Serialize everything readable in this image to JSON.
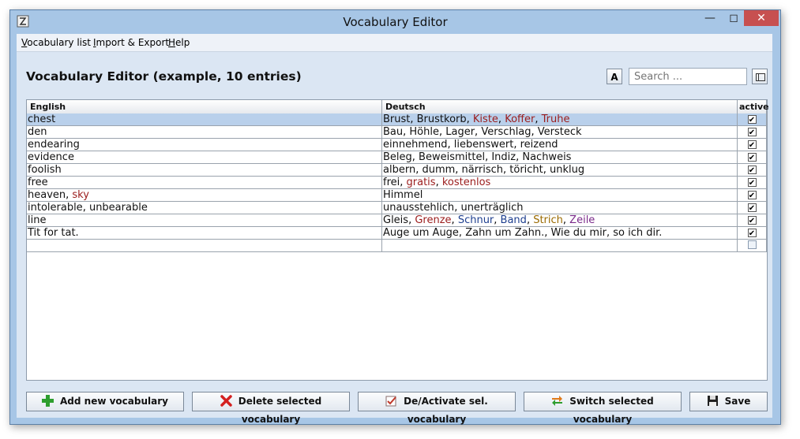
{
  "window": {
    "title": "Vocabulary Editor"
  },
  "menubar": [
    {
      "label": "Vocabulary list",
      "mnemonic": "V",
      "rest": "ocabulary list"
    },
    {
      "label": "Import & Export",
      "mnemonic": "I",
      "rest": "mport & Export"
    },
    {
      "label": "Help",
      "mnemonic": "H",
      "rest": "elp"
    }
  ],
  "header": {
    "title": "Vocabulary Editor (example, 10 entries)",
    "font_button": "A"
  },
  "search": {
    "placeholder": "Search ..."
  },
  "table": {
    "columns": [
      "English",
      "Deutsch",
      "active"
    ],
    "rows": [
      {
        "english": [
          {
            "t": "chest",
            "c": "#111111"
          }
        ],
        "deutsch": [
          {
            "t": "Brust",
            "c": "#111111"
          },
          {
            "t": "Brustkorb",
            "c": "#111111"
          },
          {
            "t": "Kiste",
            "c": "#9b1c1c"
          },
          {
            "t": "Koffer",
            "c": "#9b1c1c"
          },
          {
            "t": "Truhe",
            "c": "#9b1c1c"
          }
        ],
        "active": true,
        "selected": true
      },
      {
        "english": [
          {
            "t": "den",
            "c": "#111111"
          }
        ],
        "deutsch": [
          {
            "t": "Bau",
            "c": "#111111"
          },
          {
            "t": "Höhle",
            "c": "#111111"
          },
          {
            "t": "Lager",
            "c": "#111111"
          },
          {
            "t": "Verschlag",
            "c": "#111111"
          },
          {
            "t": "Versteck",
            "c": "#111111"
          }
        ],
        "active": true,
        "selected": false
      },
      {
        "english": [
          {
            "t": "endearing",
            "c": "#111111"
          }
        ],
        "deutsch": [
          {
            "t": "einnehmend",
            "c": "#111111"
          },
          {
            "t": "liebenswert",
            "c": "#111111"
          },
          {
            "t": "reizend",
            "c": "#111111"
          }
        ],
        "active": true,
        "selected": false
      },
      {
        "english": [
          {
            "t": "evidence",
            "c": "#111111"
          }
        ],
        "deutsch": [
          {
            "t": "Beleg",
            "c": "#111111"
          },
          {
            "t": "Beweismittel",
            "c": "#111111"
          },
          {
            "t": "Indiz",
            "c": "#111111"
          },
          {
            "t": "Nachweis",
            "c": "#111111"
          }
        ],
        "active": true,
        "selected": false
      },
      {
        "english": [
          {
            "t": "foolish",
            "c": "#111111"
          }
        ],
        "deutsch": [
          {
            "t": "albern",
            "c": "#111111"
          },
          {
            "t": "dumm",
            "c": "#111111"
          },
          {
            "t": "närrisch",
            "c": "#111111"
          },
          {
            "t": "töricht",
            "c": "#111111"
          },
          {
            "t": "unklug",
            "c": "#111111"
          }
        ],
        "active": true,
        "selected": false
      },
      {
        "english": [
          {
            "t": "free",
            "c": "#111111"
          }
        ],
        "deutsch": [
          {
            "t": "frei",
            "c": "#111111"
          },
          {
            "t": "gratis",
            "c": "#9b1c1c"
          },
          {
            "t": "kostenlos",
            "c": "#9b1c1c"
          }
        ],
        "active": true,
        "selected": false
      },
      {
        "english": [
          {
            "t": "heaven",
            "c": "#111111"
          },
          {
            "t": "sky",
            "c": "#9b1c1c"
          }
        ],
        "deutsch": [
          {
            "t": "Himmel",
            "c": "#111111"
          }
        ],
        "active": true,
        "selected": false
      },
      {
        "english": [
          {
            "t": "intolerable",
            "c": "#111111"
          },
          {
            "t": "unbearable",
            "c": "#111111"
          }
        ],
        "deutsch": [
          {
            "t": "unausstehlich",
            "c": "#111111"
          },
          {
            "t": "unerträglich",
            "c": "#111111"
          }
        ],
        "active": true,
        "selected": false
      },
      {
        "english": [
          {
            "t": "line",
            "c": "#111111"
          }
        ],
        "deutsch": [
          {
            "t": "Gleis",
            "c": "#111111"
          },
          {
            "t": "Grenze",
            "c": "#9b1c1c"
          },
          {
            "t": "Schnur",
            "c": "#1e3f8f"
          },
          {
            "t": "Band",
            "c": "#1e3f8f"
          },
          {
            "t": "Strich",
            "c": "#9a6a00"
          },
          {
            "t": "Zeile",
            "c": "#7a2a8a"
          }
        ],
        "active": true,
        "selected": false
      },
      {
        "english": [
          {
            "t": "Tit for tat.",
            "c": "#111111"
          }
        ],
        "deutsch": [
          {
            "t": "Auge um Auge, Zahn um Zahn.",
            "c": "#111111"
          },
          {
            "t": "Wie du mir, so ich dir.",
            "c": "#111111"
          }
        ],
        "active": true,
        "selected": false
      },
      {
        "english": [],
        "deutsch": [],
        "active": false,
        "selected": false
      }
    ]
  },
  "buttons": [
    {
      "label": "Add new vocabulary",
      "icon": "plus-icon"
    },
    {
      "label": "Delete selected vocabulary",
      "icon": "delete-x-icon"
    },
    {
      "label": "De/Activate sel. vocabulary",
      "icon": "checklist-icon"
    },
    {
      "label": "Switch selected vocabulary",
      "icon": "switch-arrows-icon"
    },
    {
      "label": "Save",
      "icon": "floppy-disk-icon"
    }
  ],
  "colors": {
    "accent": "#9b1c1c",
    "blue_word": "#1e3f8f",
    "selection": "#b9d0eb",
    "window_frame": "#a7c6e6"
  }
}
